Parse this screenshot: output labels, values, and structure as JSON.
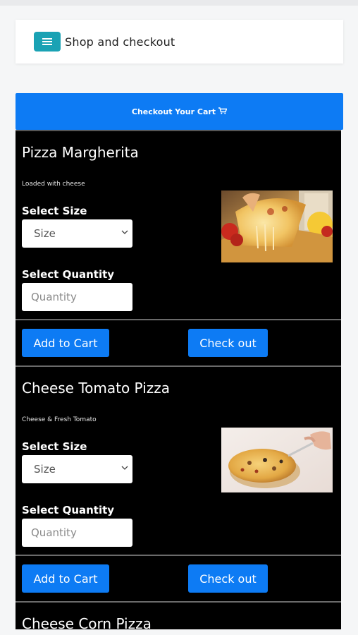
{
  "header": {
    "menu_icon": "hamburger-menu-icon",
    "title": "Shop and checkout"
  },
  "checkout_banner": {
    "label": "Checkout Your Cart",
    "icon": "cart-icon"
  },
  "products": [
    {
      "name": "Pizza Margherita",
      "description": "Loaded with cheese",
      "size_label": "Select Size",
      "size_value": "Size",
      "quantity_label": "Select Quantity",
      "quantity_placeholder": "Quantity",
      "add_label": "Add to Cart",
      "checkout_label": "Check out"
    },
    {
      "name": "Cheese Tomato Pizza",
      "description": "Cheese & Fresh Tomato",
      "size_label": "Select Size",
      "size_value": "Size",
      "quantity_label": "Select Quantity",
      "quantity_placeholder": "Quantity",
      "add_label": "Add to Cart",
      "checkout_label": "Check out"
    },
    {
      "name": "Cheese Corn Pizza"
    }
  ],
  "colors": {
    "primary": "#0d7bf4",
    "menu_button": "#1aa2b4",
    "card_bg": "#000000"
  }
}
